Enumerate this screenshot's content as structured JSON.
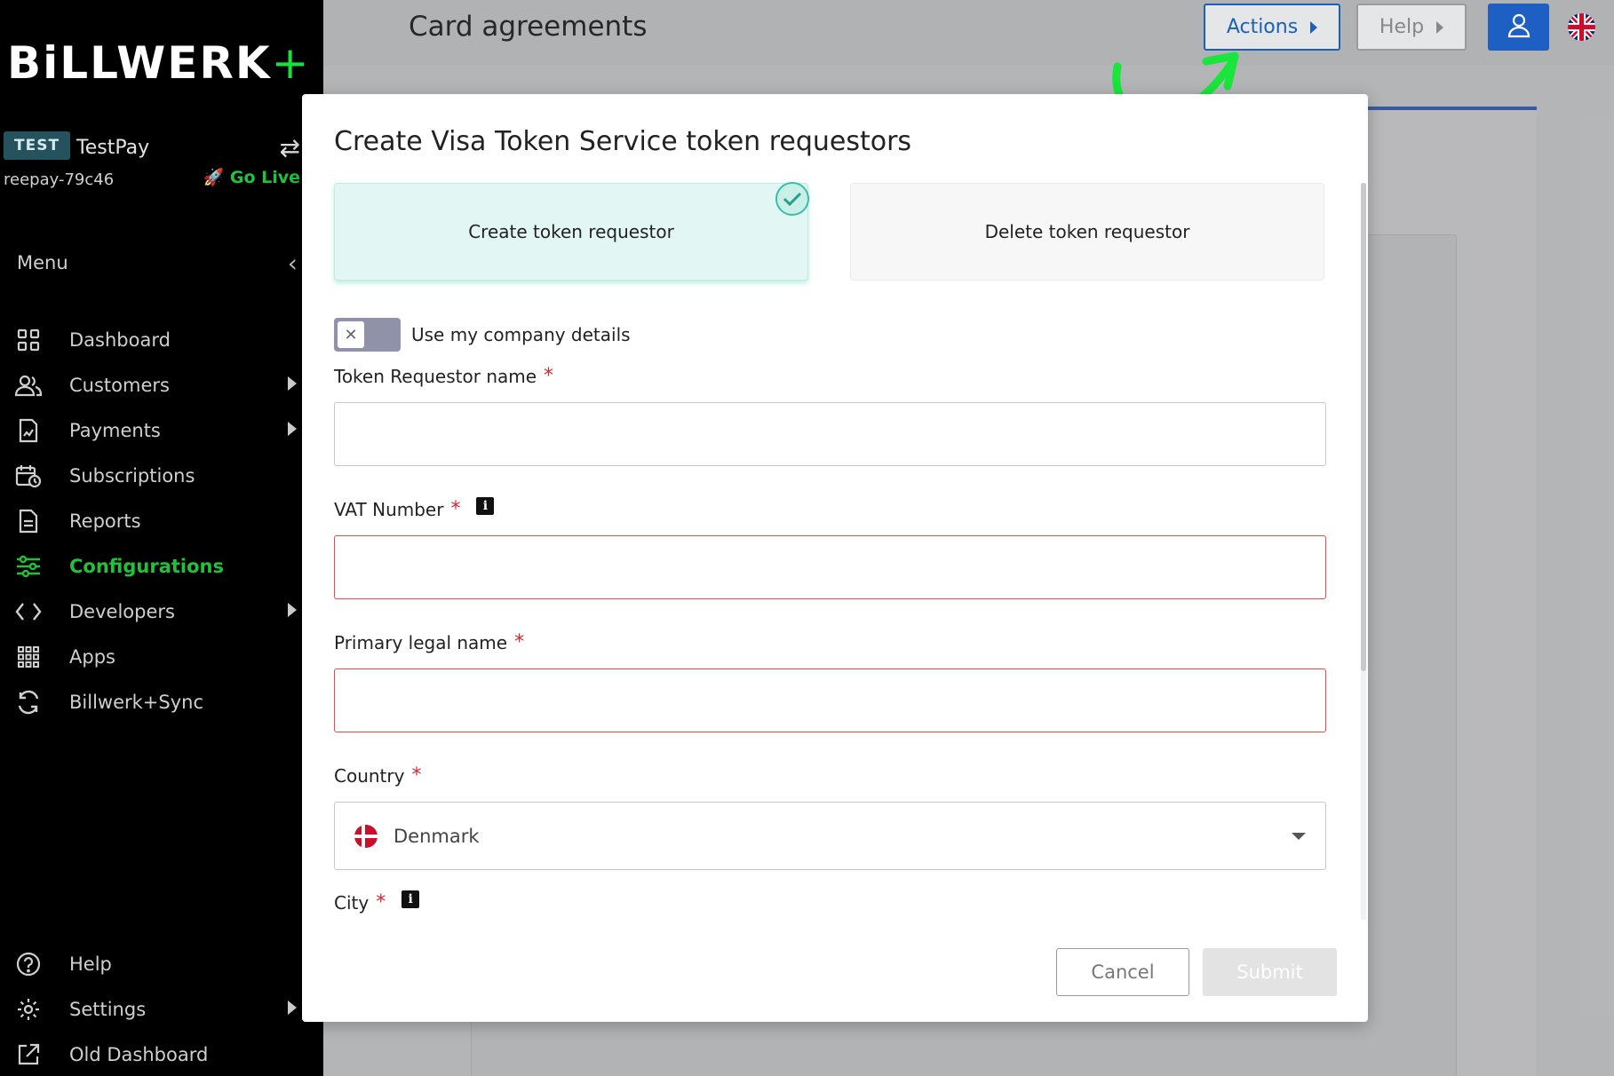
{
  "sidebar": {
    "logo_text": "BiLLWERK",
    "logo_plus": "+",
    "account": {
      "env_badge": "TEST",
      "name": "TestPay",
      "id": "reepay-79c46",
      "go_live": "Go Live"
    },
    "menu_label": "Menu",
    "items": [
      {
        "label": "Dashboard",
        "icon": "grid-icon"
      },
      {
        "label": "Customers",
        "icon": "users-icon"
      },
      {
        "label": "Payments",
        "icon": "invoice-icon"
      },
      {
        "label": "Subscriptions",
        "icon": "calendar-clock-icon"
      },
      {
        "label": "Reports",
        "icon": "document-icon"
      },
      {
        "label": "Configurations",
        "icon": "sliders-icon"
      },
      {
        "label": "Developers",
        "icon": "code-icon"
      },
      {
        "label": "Apps",
        "icon": "apps-grid-icon"
      },
      {
        "label": "Billwerk+Sync",
        "icon": "sync-icon"
      }
    ],
    "bottom_items": [
      {
        "label": "Help",
        "icon": "help-circle-icon"
      },
      {
        "label": "Settings",
        "icon": "gear-icon"
      },
      {
        "label": "Old Dashboard",
        "icon": "external-link-icon"
      }
    ]
  },
  "header": {
    "title": "Card agreements",
    "actions_label": "Actions",
    "help_label": "Help"
  },
  "modal": {
    "title": "Create Visa Token Service token requestors",
    "options": {
      "create": "Create token requestor",
      "delete": "Delete token requestor"
    },
    "toggle_label": "Use my company details",
    "fields": {
      "token_requestor_name": {
        "label": "Token Requestor name",
        "value": "",
        "placeholder": ""
      },
      "vat_number": {
        "label": "VAT Number",
        "value": "",
        "placeholder": ""
      },
      "primary_legal_name": {
        "label": "Primary legal name",
        "value": "",
        "placeholder": ""
      },
      "country": {
        "label": "Country",
        "value": "Denmark"
      },
      "city": {
        "label": "City"
      }
    },
    "required_mark": "*",
    "info_mark": "i",
    "cancel_label": "Cancel",
    "submit_label": "Submit"
  },
  "colors": {
    "brand_green": "#19e03c",
    "primary_blue": "#1e5fc4",
    "teal_selected": "#3abfa6",
    "error_red": "#e44b4b"
  }
}
